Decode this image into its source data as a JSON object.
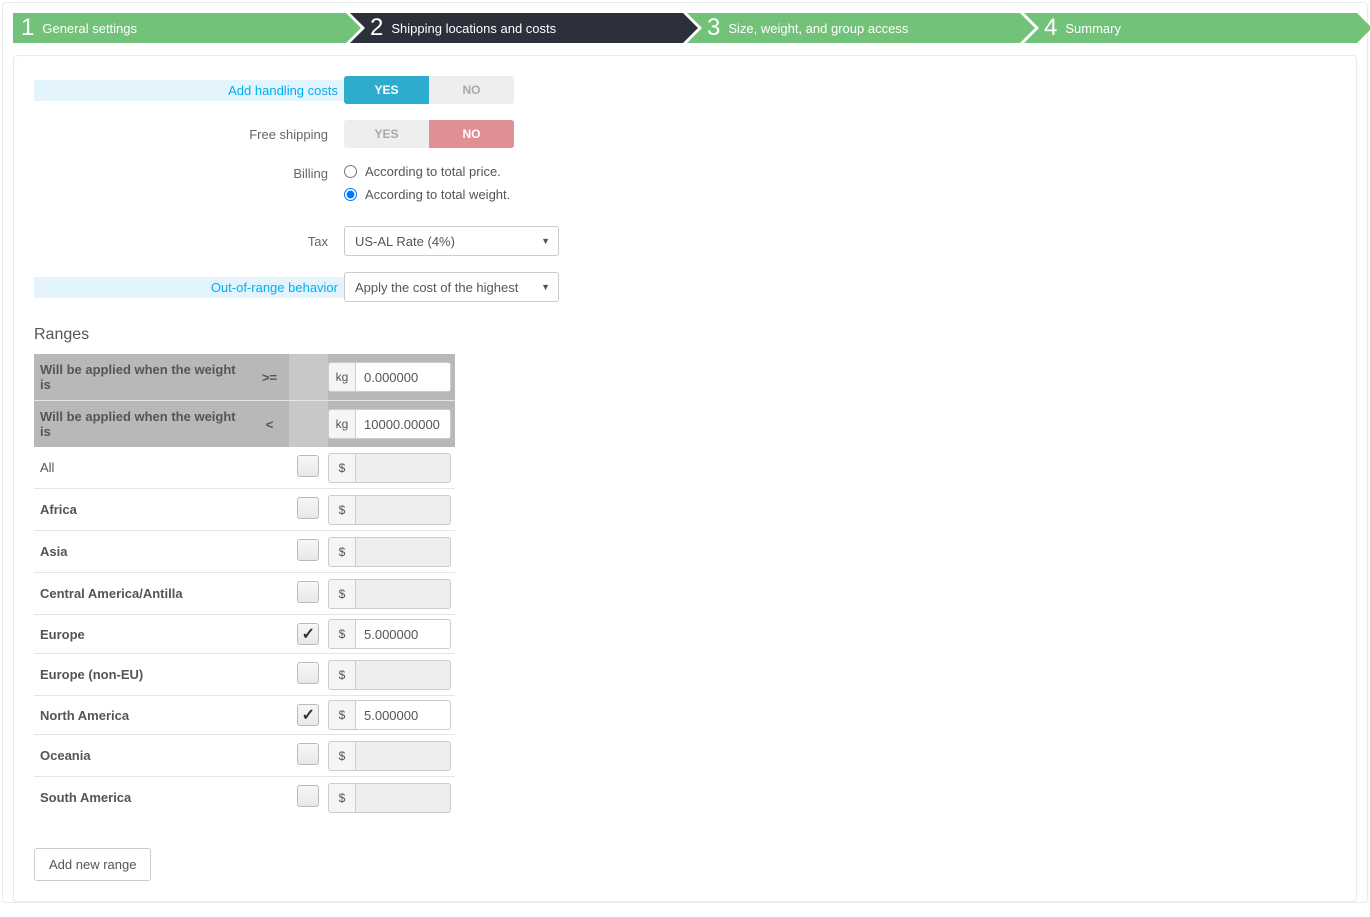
{
  "steps": [
    {
      "num": "1",
      "label": "General settings"
    },
    {
      "num": "2",
      "label": "Shipping locations and costs"
    },
    {
      "num": "3",
      "label": "Size, weight, and group access"
    },
    {
      "num": "4",
      "label": "Summary"
    }
  ],
  "active_step": 1,
  "form": {
    "add_handling_label": "Add handling costs",
    "add_handling_value": true,
    "free_shipping_label": "Free shipping",
    "free_shipping_value": false,
    "billing_label": "Billing",
    "billing_opt_price": "According to total price.",
    "billing_opt_weight": "According to total weight.",
    "billing_value": "weight",
    "tax_label": "Tax",
    "tax_value": "US-AL Rate (4%)",
    "oor_label": "Out-of-range behavior",
    "oor_value": "Apply the cost of the highest",
    "yes": "YES",
    "no": "NO"
  },
  "ranges": {
    "title": "Ranges",
    "r1_label": "Will be applied when the weight is",
    "r1_op": ">=",
    "r1_unit": "kg",
    "r1_value": "0.000000",
    "r2_label": "Will be applied when the weight is",
    "r2_op": "<",
    "r2_unit": "kg",
    "r2_value": "10000.00000",
    "currency": "$",
    "regions": [
      {
        "name": "All",
        "checked": false,
        "value": "",
        "all": true
      },
      {
        "name": "Africa",
        "checked": false,
        "value": ""
      },
      {
        "name": "Asia",
        "checked": false,
        "value": ""
      },
      {
        "name": "Central America/Antilla",
        "checked": false,
        "value": ""
      },
      {
        "name": "Europe",
        "checked": true,
        "value": "5.000000"
      },
      {
        "name": "Europe (non-EU)",
        "checked": false,
        "value": ""
      },
      {
        "name": "North America",
        "checked": true,
        "value": "5.000000"
      },
      {
        "name": "Oceania",
        "checked": false,
        "value": ""
      },
      {
        "name": "South America",
        "checked": false,
        "value": ""
      }
    ],
    "add_range": "Add new range"
  }
}
